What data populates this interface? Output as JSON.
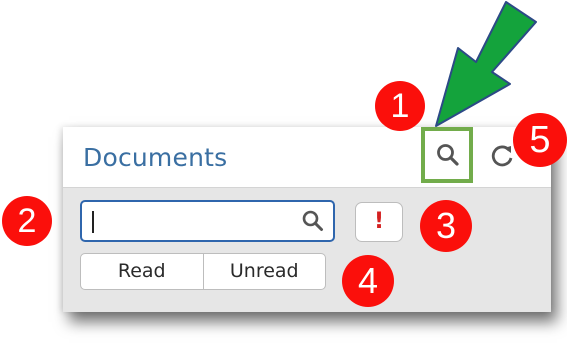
{
  "panel": {
    "title": "Documents",
    "icons": [
      "eye-icon",
      "search-icon",
      "refresh-icon"
    ]
  },
  "search": {
    "value": "",
    "placeholder": ""
  },
  "priority_button": {
    "label": "!",
    "color": "#d42020"
  },
  "filters": {
    "options": [
      "Read",
      "Unread"
    ]
  },
  "callouts": [
    "1",
    "2",
    "3",
    "4",
    "5"
  ],
  "colors": {
    "title": "#3a6fa2",
    "input_border": "#2f66ad",
    "highlight_box": "#72ac4b",
    "arrow": "#14a33c",
    "callout": "#fb0f0b"
  }
}
